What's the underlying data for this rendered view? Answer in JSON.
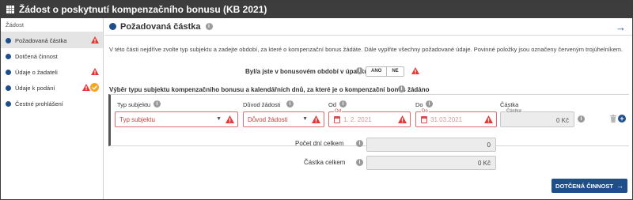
{
  "window": {
    "title": "Žádost o poskytnutí kompenzačního bonusu (KB 2021)"
  },
  "sidebar": {
    "heading": "Žádost",
    "items": [
      {
        "label": "Požadovaná částka"
      },
      {
        "label": "Dotčená činnost"
      },
      {
        "label": "Údaje o žadateli"
      },
      {
        "label": "Údaje k podání"
      },
      {
        "label": "Čestné prohlášení"
      }
    ]
  },
  "main": {
    "title": "Požadovaná částka",
    "intro": "V této části nejdříve zvolte typ subjektu a zadejte období, za které o kompenzační bonus žádáte. Dále vyplňte všechny požadované údaje. Povinné položky jsou označeny červeným trojúhelníkem.",
    "question": {
      "label": "Byl/a jste v bonusovém období v úpadku",
      "yes": "ANO",
      "no": "NE"
    },
    "section_title": "Výběr typu subjektu kompenzačního bonusu a kalendářních dnů, za které je o kompenzační bonus žádáno",
    "columns": {
      "subject_type": "Typ subjektu",
      "reason": "Důvod žádosti",
      "from": "Od",
      "to": "Do",
      "amount": "Částka"
    },
    "row": {
      "subject_type": "Typ subjektu",
      "reason": "Důvod žádosti",
      "from_legend": "Od",
      "from_value": "1. 2. 2021",
      "to_legend": "Do",
      "to_value": "31.03.2021",
      "amount_legend": "Částka",
      "amount_value": "0 Kč"
    },
    "summary": {
      "days_label": "Počet dní celkem",
      "days_value": "0",
      "amount_label": "Částka celkem",
      "amount_value": "0 Kč"
    },
    "next_button": "DOTČENÁ ČINNOST"
  },
  "colors": {
    "titlebar": "#3d3d3d",
    "accent": "#1f4e8c",
    "warning": "#e53935",
    "ok": "#f5a623"
  },
  "icons": {
    "title": "grid-icon",
    "warning": "warning-triangle-icon",
    "ok": "check-circle-icon",
    "info": "info-icon",
    "next": "arrow-right-icon",
    "calendar": "calendar-icon",
    "trash": "trash-icon",
    "add": "plus-circle-icon"
  }
}
